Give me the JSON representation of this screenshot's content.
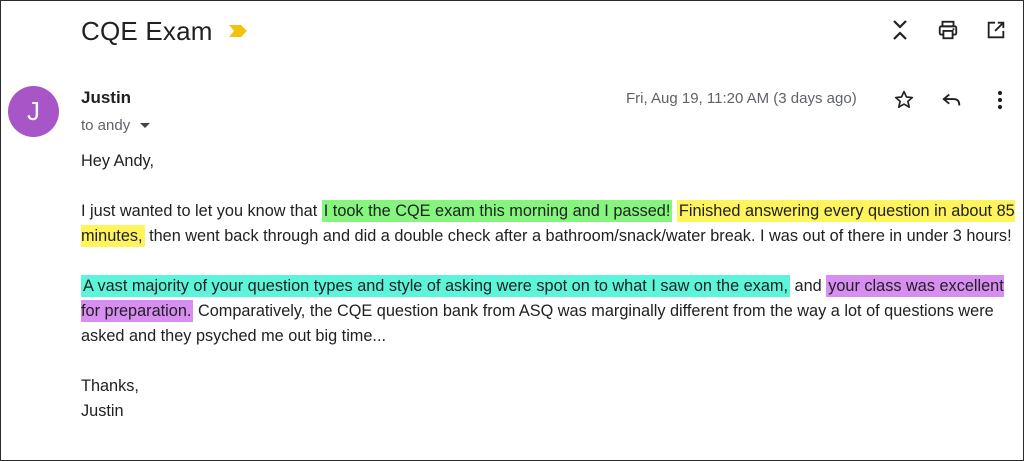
{
  "email": {
    "subject": "CQE Exam",
    "sender_initial": "J",
    "sender_name": "Justin",
    "to_line": "to andy",
    "date": "Fri, Aug 19, 11:20 AM (3 days ago)"
  },
  "colors": {
    "avatar": "#a855c7",
    "importance_marker": "#f4c20d",
    "highlight_green": "#86f57e",
    "highlight_yellow": "#fff45b",
    "highlight_cyan": "#5cf5d9",
    "highlight_purple": "#d88df0"
  },
  "icons": {
    "top": [
      "expand-collapse-icon",
      "print-icon",
      "open-new-window-icon"
    ],
    "message": [
      "star-icon",
      "reply-icon",
      "more-vert-icon"
    ]
  },
  "body": {
    "greeting": "Hey Andy,",
    "p1_a": "I just wanted to let you know that ",
    "p1_green": "I took the CQE exam this morning and I passed!",
    "p1_b": " ",
    "p1_yellow": "Finished answering every question in about 85 minutes,",
    "p1_c": " then went back through and did a double check after a bathroom/snack/water break. I was out of there in under 3 hours!",
    "p2_cyan": "A vast majority of your question types and style of asking were spot on to what I saw on the exam,",
    "p2_a": " and ",
    "p2_purple": "your class was excellent for preparation.",
    "p2_b": " Comparatively, the CQE question bank from ASQ was marginally different from the way a lot of questions were asked and they psyched me out big time...",
    "signoff": "Thanks,",
    "signature": "Justin"
  }
}
